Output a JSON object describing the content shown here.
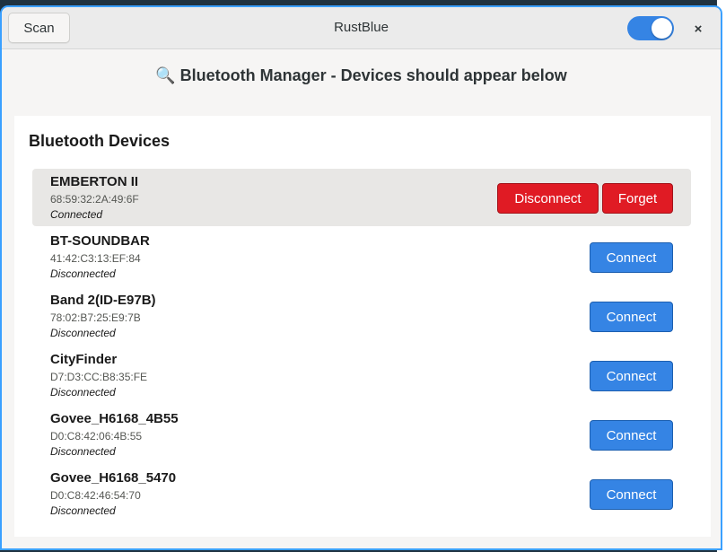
{
  "window": {
    "title": "RustBlue",
    "scan_label": "Scan",
    "close_glyph": "×",
    "toggle_on": true,
    "accent_color": "#3584e4",
    "danger_color": "#e01b24"
  },
  "banner": {
    "icon": "🔍",
    "text": "Bluetooth Manager - Devices should appear below"
  },
  "panel": {
    "title": "Bluetooth Devices"
  },
  "devices": [
    {
      "name": "EMBERTON II",
      "mac": "68:59:32:2A:49:6F",
      "status": "Connected",
      "disconnect_label": "Disconnect",
      "forget_label": "Forget"
    },
    {
      "name": "BT-SOUNDBAR",
      "mac": "41:42:C3:13:EF:84",
      "status": "Disconnected",
      "connect_label": "Connect"
    },
    {
      "name": "Band 2(ID-E97B)",
      "mac": "78:02:B7:25:E9:7B",
      "status": "Disconnected",
      "connect_label": "Connect"
    },
    {
      "name": "CityFinder",
      "mac": "D7:D3:CC:B8:35:FE",
      "status": "Disconnected",
      "connect_label": "Connect"
    },
    {
      "name": "Govee_H6168_4B55",
      "mac": "D0:C8:42:06:4B:55",
      "status": "Disconnected",
      "connect_label": "Connect"
    },
    {
      "name": "Govee_H6168_5470",
      "mac": "D0:C8:42:46:54:70",
      "status": "Disconnected",
      "connect_label": "Connect"
    }
  ]
}
